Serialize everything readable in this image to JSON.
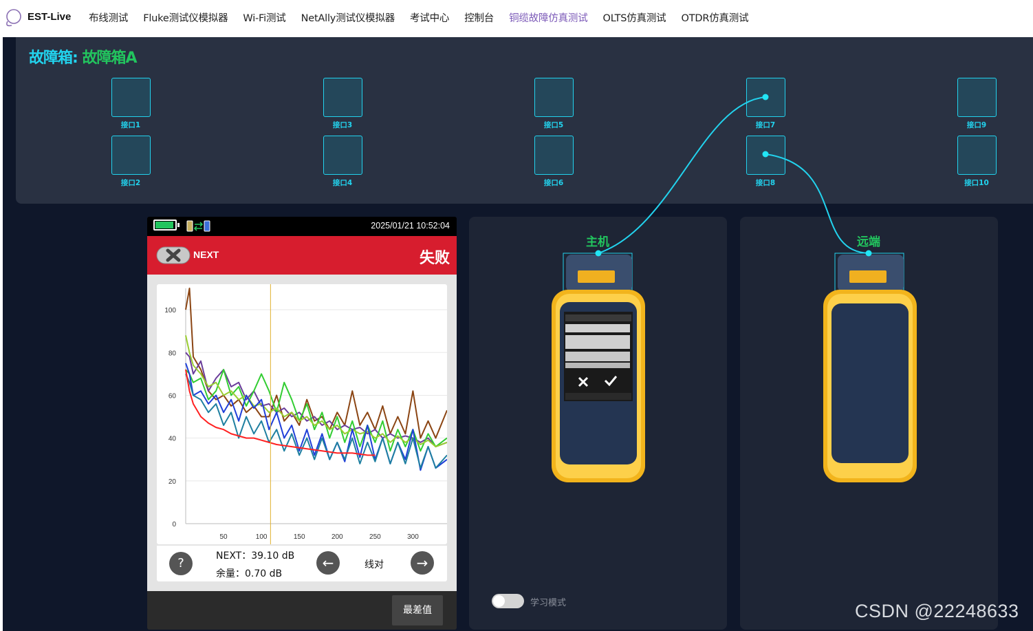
{
  "nav": {
    "brand": "EST-Live",
    "items": [
      {
        "label": "布线测试",
        "active": false
      },
      {
        "label": "Fluke测试仪模拟器",
        "active": false
      },
      {
        "label": "Wi-Fi测试",
        "active": false
      },
      {
        "label": "NetAlly测试仪模拟器",
        "active": false
      },
      {
        "label": "考试中心",
        "active": false
      },
      {
        "label": "控制台",
        "active": false
      },
      {
        "label": "铜缆故障仿真测试",
        "active": true
      },
      {
        "label": "OLTS仿真测试",
        "active": false
      },
      {
        "label": "OTDR仿真测试",
        "active": false
      }
    ]
  },
  "fault_box": {
    "title_prefix": "故障箱: ",
    "title_name": "故障箱A",
    "ports": [
      "接口1",
      "接口2",
      "接口3",
      "接口4",
      "接口5",
      "接口6",
      "接口7",
      "接口8",
      "接口9",
      "接口10"
    ]
  },
  "tester": {
    "datetime": "2025/01/21 10:52:04",
    "test_name": "NEXT",
    "result": "失败",
    "next_value": "NEXT：39.10 dB",
    "margin_value": "余量：0.70 dB",
    "pair": "线对",
    "help_icon": "?",
    "prev_icon": "←",
    "next_icon": "→",
    "worst_button": "最差值"
  },
  "chart_data": {
    "type": "line",
    "title": "",
    "xlabel": "",
    "ylabel": "",
    "x_ticks": [
      50,
      100,
      150,
      200,
      250,
      300
    ],
    "y_ticks": [
      0,
      20,
      40,
      60,
      80,
      100
    ],
    "xlim": [
      0,
      345
    ],
    "ylim": [
      0,
      110
    ],
    "cursor_x": 112,
    "series": [
      {
        "color": "#8b4513",
        "x": [
          0,
          5,
          10,
          20,
          30,
          40,
          50,
          60,
          70,
          80,
          90,
          100,
          110,
          120,
          130,
          140,
          150,
          160,
          170,
          180,
          190,
          200,
          210,
          220,
          230,
          240,
          250,
          260,
          270,
          280,
          290,
          300,
          310,
          320,
          330,
          345
        ],
        "y": [
          100,
          110,
          78,
          72,
          62,
          58,
          60,
          55,
          58,
          52,
          55,
          50,
          50,
          60,
          48,
          52,
          46,
          58,
          48,
          50,
          44,
          52,
          46,
          62,
          46,
          52,
          44,
          55,
          42,
          50,
          42,
          62,
          40,
          48,
          40,
          53
        ]
      },
      {
        "color": "#6a3d9a",
        "x": [
          0,
          5,
          10,
          20,
          30,
          40,
          50,
          60,
          70,
          80,
          90,
          100,
          110,
          120,
          130,
          140,
          150,
          160,
          170,
          180,
          190,
          200,
          210,
          220,
          230,
          240,
          250,
          260,
          270,
          280,
          290,
          300,
          310,
          320,
          330,
          345
        ],
        "y": [
          80,
          78,
          70,
          76,
          62,
          68,
          72,
          64,
          66,
          58,
          62,
          55,
          56,
          52,
          54,
          50,
          52,
          48,
          50,
          46,
          48,
          44,
          46,
          44,
          45,
          42,
          44,
          40,
          42,
          40,
          41,
          40,
          38,
          40,
          36,
          38
        ]
      },
      {
        "color": "#32cd32",
        "x": [
          0,
          5,
          10,
          20,
          30,
          40,
          50,
          60,
          70,
          80,
          90,
          100,
          110,
          120,
          130,
          140,
          150,
          160,
          170,
          180,
          190,
          200,
          210,
          220,
          230,
          240,
          250,
          260,
          270,
          280,
          290,
          300,
          310,
          320,
          330,
          345
        ],
        "y": [
          72,
          70,
          66,
          68,
          58,
          62,
          72,
          60,
          64,
          55,
          62,
          70,
          62,
          52,
          66,
          58,
          48,
          56,
          44,
          52,
          40,
          50,
          38,
          48,
          36,
          46,
          38,
          48,
          34,
          44,
          36,
          44,
          34,
          42,
          36,
          40
        ]
      },
      {
        "color": "#9acd32",
        "x": [
          0,
          5,
          10,
          20,
          30,
          40,
          50,
          60,
          70,
          80,
          90,
          100,
          110,
          120,
          130,
          140,
          150,
          160,
          170,
          180,
          190,
          200,
          210,
          220,
          230,
          240,
          250,
          260,
          270,
          280,
          290,
          300,
          310,
          320,
          330,
          345
        ],
        "y": [
          88,
          80,
          74,
          70,
          64,
          66,
          60,
          62,
          58,
          60,
          55,
          56,
          52,
          54,
          50,
          52,
          48,
          50,
          46,
          48,
          44,
          46,
          42,
          44,
          42,
          43,
          40,
          42,
          38,
          41,
          38,
          40,
          37,
          39,
          36,
          38
        ]
      },
      {
        "color": "#1f3fd8",
        "x": [
          0,
          5,
          10,
          20,
          30,
          40,
          50,
          60,
          70,
          80,
          90,
          100,
          110,
          120,
          130,
          140,
          150,
          160,
          170,
          180,
          190,
          200,
          210,
          220,
          230,
          240,
          250,
          260,
          270,
          280,
          290,
          300,
          310,
          320,
          330,
          345
        ],
        "y": [
          75,
          70,
          60,
          62,
          56,
          60,
          52,
          58,
          48,
          60,
          54,
          58,
          44,
          52,
          40,
          46,
          34,
          44,
          32,
          42,
          30,
          38,
          29,
          44,
          31,
          46,
          30,
          40,
          28,
          38,
          30,
          44,
          25,
          36,
          26,
          30
        ]
      },
      {
        "color": "#1e7fa0",
        "x": [
          0,
          5,
          10,
          20,
          30,
          40,
          50,
          60,
          70,
          80,
          90,
          100,
          110,
          120,
          130,
          140,
          150,
          160,
          170,
          180,
          190,
          200,
          210,
          220,
          230,
          240,
          250,
          260,
          270,
          280,
          290,
          300,
          310,
          320,
          330,
          345
        ],
        "y": [
          70,
          66,
          60,
          58,
          52,
          56,
          46,
          52,
          40,
          50,
          42,
          48,
          38,
          44,
          34,
          42,
          32,
          40,
          30,
          40,
          30,
          38,
          30,
          40,
          28,
          38,
          29,
          40,
          28,
          38,
          28,
          40,
          26,
          36,
          26,
          32
        ]
      },
      {
        "color": "#ff2020",
        "x": [
          0,
          5,
          10,
          20,
          30,
          40,
          50,
          60,
          70,
          80,
          90,
          100,
          120,
          140,
          160,
          180,
          200,
          220,
          240,
          250
        ],
        "y": [
          72,
          62,
          56,
          50,
          47,
          45,
          44,
          42,
          41,
          40,
          40,
          39,
          37,
          36,
          35,
          34,
          33,
          33,
          32,
          32
        ]
      }
    ]
  },
  "host_panel": {
    "title": "主机"
  },
  "remote_panel": {
    "title": "远端"
  },
  "learn_mode": {
    "label": "学习模式"
  },
  "watermark": "CSDN @22248633",
  "colors": {
    "accent_cyan": "#22d3ee",
    "accent_green": "#22c55e",
    "fail_red": "#d71d2e",
    "active_nav": "#7c5ab8"
  }
}
